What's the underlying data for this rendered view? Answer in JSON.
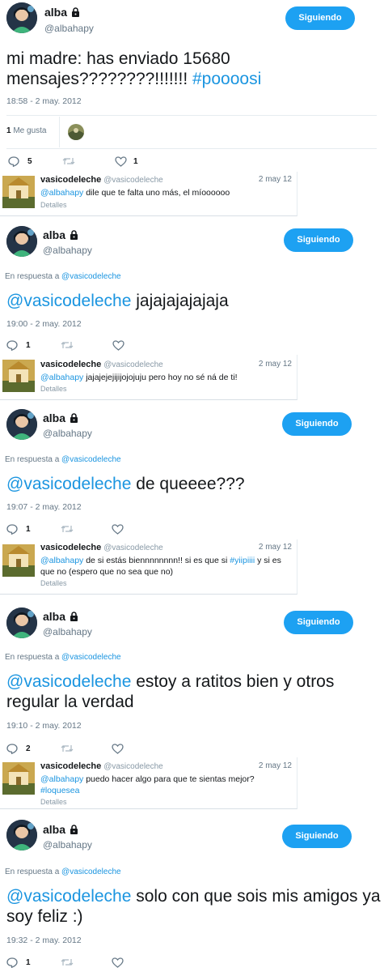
{
  "colors": {
    "accent": "#1da1f2",
    "link": "#1b95e0",
    "muted": "#657786",
    "text": "#14171a",
    "divider": "#e6ecf0"
  },
  "icons": {
    "reply": "reply-icon",
    "retweet": "retweet-icon",
    "like": "heart-icon",
    "lock": "lock-icon"
  },
  "author": {
    "name": "alba",
    "handle": "@albahapy",
    "follow_label": "Siguiendo"
  },
  "tweets": [
    {
      "reply_prefix": "",
      "reply_mention": "",
      "text_plain": "mi madre: has enviado 15680 mensajes????????!!!!!!! ",
      "text_mention": "",
      "text_hashtag": "#poooosi",
      "timestamp": "18:58 - 2 may. 2012",
      "likes_count": "1",
      "likes_label": "Me gusta",
      "reply_count": "5",
      "retweet_count": "",
      "like_count": "1"
    },
    {
      "reply_prefix": "En respuesta a",
      "reply_mention": "@vasicodeleche",
      "text_mention": "@vasicodeleche",
      "text_plain": " jajajajajajaja",
      "timestamp": "19:00 - 2 may. 2012",
      "reply_count": "1"
    },
    {
      "reply_prefix": "En respuesta a",
      "reply_mention": "@vasicodeleche",
      "text_mention": "@vasicodeleche",
      "text_plain": " de queeee???",
      "timestamp": "19:07 - 2 may. 2012",
      "reply_count": "1"
    },
    {
      "reply_prefix": "En respuesta a",
      "reply_mention": "@vasicodeleche",
      "text_mention": "@vasicodeleche",
      "text_plain": " estoy a ratitos bien y otros regular la verdad",
      "timestamp": "19:10 - 2 may. 2012",
      "reply_count": "2"
    },
    {
      "reply_prefix": "En respuesta a",
      "reply_mention": "@vasicodeleche",
      "text_mention": "@vasicodeleche",
      "text_plain": " solo con que sois mis amigos ya soy feliz :)",
      "timestamp": "19:32 - 2 may. 2012",
      "reply_count": "1"
    }
  ],
  "quotes": [
    {
      "name": "vasicodeleche",
      "handle": "@vasicodeleche",
      "date": "2 may 12",
      "mention": "@albahapy",
      "text": " dile que te falta uno más, el míoooooo",
      "text_after_hashtag": "",
      "hashtag": "",
      "tail": "",
      "details": "Detalles"
    },
    {
      "name": "vasicodeleche",
      "handle": "@vasicodeleche",
      "date": "2 may 12",
      "mention": "@albahapy",
      "text": " jajajejejijijojojuju pero hoy no sé ná de ti!",
      "hashtag": "",
      "tail": "",
      "details": "Detalles"
    },
    {
      "name": "vasicodeleche",
      "handle": "@vasicodeleche",
      "date": "2 may 12",
      "mention": "@albahapy",
      "text": " de si estás biennnnnnnn!! si es que si ",
      "hashtag": "#yiipiiii",
      "tail": " y si es que no (espero que no sea que no)",
      "details": "Detalles"
    },
    {
      "name": "vasicodeleche",
      "handle": "@vasicodeleche",
      "date": "2 may 12",
      "mention": "@albahapy",
      "text": " puedo hacer algo para que te sientas mejor? ",
      "hashtag": "#loquesea",
      "tail": "",
      "details": "Detalles"
    }
  ]
}
